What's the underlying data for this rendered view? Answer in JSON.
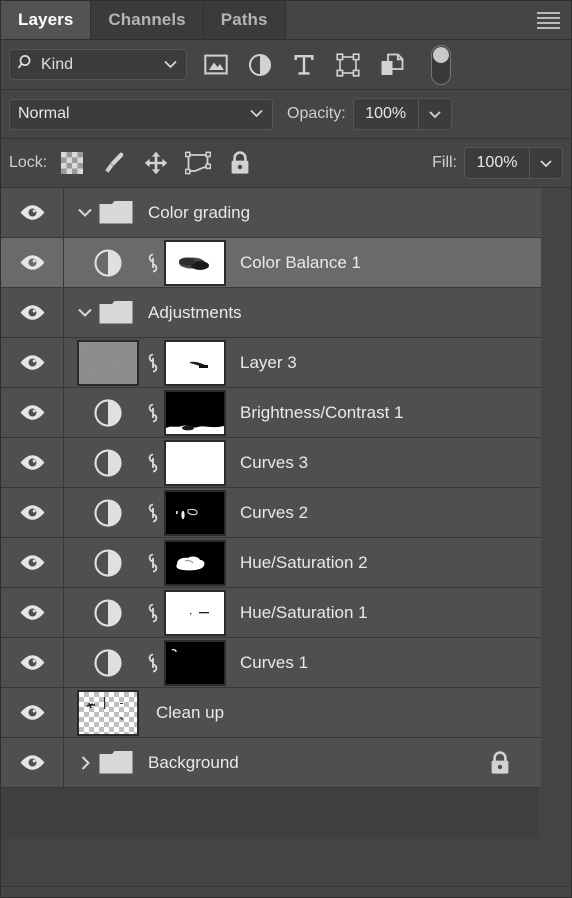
{
  "panel": {
    "tabs": [
      {
        "label": "Layers",
        "active": true
      },
      {
        "label": "Channels",
        "active": false
      },
      {
        "label": "Paths",
        "active": false
      }
    ],
    "menu_icon": "hamburger-menu-icon"
  },
  "filter": {
    "kind_label": "Kind",
    "search_icon": "search-icon",
    "chevron_icon": "chevron-down-icon",
    "icons": [
      "pixel-layer-filter-icon",
      "adjustment-layer-filter-icon",
      "type-layer-filter-icon",
      "shape-layer-filter-icon",
      "smart-object-filter-icon",
      "filter-toggle-switch"
    ]
  },
  "blend": {
    "mode": "Normal",
    "opacity_label": "Opacity:",
    "opacity_value": "100%"
  },
  "lock": {
    "label": "Lock:",
    "icons": [
      "lock-transparent-pixels-icon",
      "lock-image-pixels-icon",
      "lock-position-icon",
      "lock-artboard-nesting-icon",
      "lock-all-icon"
    ],
    "fill_label": "Fill:",
    "fill_value": "100%"
  },
  "colors": {
    "panel_bg": "#444444",
    "row_bg": "#4f4f4f",
    "row_selected_bg": "#6a6a6a",
    "tab_active_bg": "#535353",
    "text": "#e9e9e9"
  },
  "layers": [
    {
      "name": "Color grading",
      "type": "group",
      "visible": true,
      "expanded": true,
      "indent": 0,
      "selected": false,
      "locked": false
    },
    {
      "name": "Color Balance 1",
      "type": "adjustment",
      "visible": true,
      "indent": 1,
      "selected": true,
      "locked": false,
      "mask": "blurred-dark-blob",
      "linked": true
    },
    {
      "name": "Adjustments",
      "type": "group",
      "visible": true,
      "expanded": true,
      "indent": 0,
      "selected": false,
      "locked": false
    },
    {
      "name": "Layer 3",
      "type": "pixel",
      "visible": true,
      "indent": 1,
      "selected": false,
      "locked": false,
      "thumbnail": "gray-noise",
      "mask": "white-with-dark-streak",
      "linked": true
    },
    {
      "name": "Brightness/Contrast 1",
      "type": "adjustment",
      "visible": true,
      "indent": 1,
      "selected": false,
      "locked": false,
      "mask": "black-with-white-bottom",
      "linked": true
    },
    {
      "name": "Curves 3",
      "type": "adjustment",
      "visible": true,
      "indent": 1,
      "selected": false,
      "locked": false,
      "mask": "all-white",
      "linked": true
    },
    {
      "name": "Curves 2",
      "type": "adjustment",
      "visible": true,
      "indent": 1,
      "selected": false,
      "locked": false,
      "mask": "black-with-small-white-marks",
      "linked": true
    },
    {
      "name": "Hue/Saturation 2",
      "type": "adjustment",
      "visible": true,
      "indent": 1,
      "selected": false,
      "locked": false,
      "mask": "black-with-white-blob",
      "linked": true
    },
    {
      "name": "Hue/Saturation 1",
      "type": "adjustment",
      "visible": true,
      "indent": 1,
      "selected": false,
      "locked": false,
      "mask": "white-with-small-dark-marks",
      "linked": true
    },
    {
      "name": "Curves 1",
      "type": "adjustment",
      "visible": true,
      "indent": 1,
      "selected": false,
      "locked": false,
      "mask": "black-with-tiny-white-mark",
      "linked": true
    },
    {
      "name": "Clean up",
      "type": "pixel",
      "visible": true,
      "indent": 1,
      "selected": false,
      "locked": false,
      "thumbnail": "transparent-checkerboard",
      "linked": false
    },
    {
      "name": "Background",
      "type": "group",
      "visible": true,
      "expanded": false,
      "indent": 0,
      "selected": false,
      "locked": true
    }
  ]
}
